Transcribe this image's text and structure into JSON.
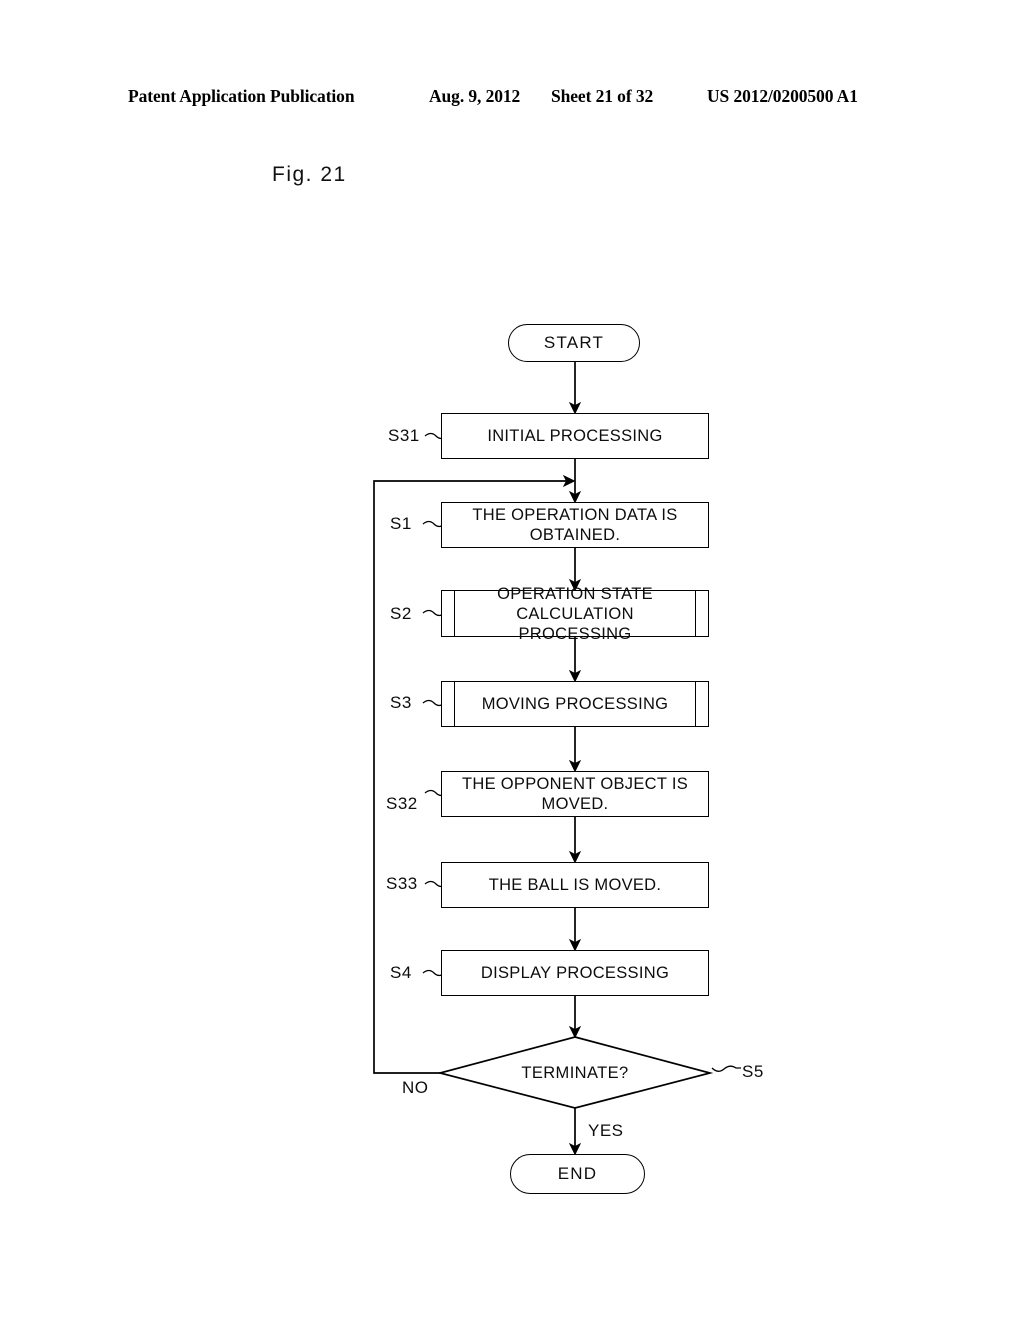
{
  "header": {
    "publication": "Patent Application Publication",
    "date": "Aug. 9, 2012",
    "sheet": "Sheet 21 of 32",
    "doc_number": "US 2012/0200500 A1"
  },
  "figure": {
    "label": "Fig. 21"
  },
  "flowchart": {
    "start": "START",
    "end": "END",
    "nodes": [
      {
        "step": "S31",
        "text": "INITIAL PROCESSING",
        "shape": "process"
      },
      {
        "step": "S1",
        "text": "THE OPERATION DATA IS OBTAINED.",
        "shape": "process"
      },
      {
        "step": "S2",
        "text": "OPERATION STATE CALCULATION PROCESSING",
        "shape": "predefined-process"
      },
      {
        "step": "S3",
        "text": "MOVING PROCESSING",
        "shape": "predefined-process"
      },
      {
        "step": "S32",
        "text": "THE OPPONENT OBJECT IS MOVED.",
        "shape": "process"
      },
      {
        "step": "S33",
        "text": "THE BALL IS MOVED.",
        "shape": "process"
      },
      {
        "step": "S4",
        "text": "DISPLAY PROCESSING",
        "shape": "process"
      },
      {
        "step": "S5",
        "text": "TERMINATE?",
        "shape": "decision"
      }
    ],
    "branches": {
      "no": "NO",
      "yes": "YES"
    }
  },
  "colors": {
    "ink": "#000000",
    "paper": "#ffffff"
  }
}
